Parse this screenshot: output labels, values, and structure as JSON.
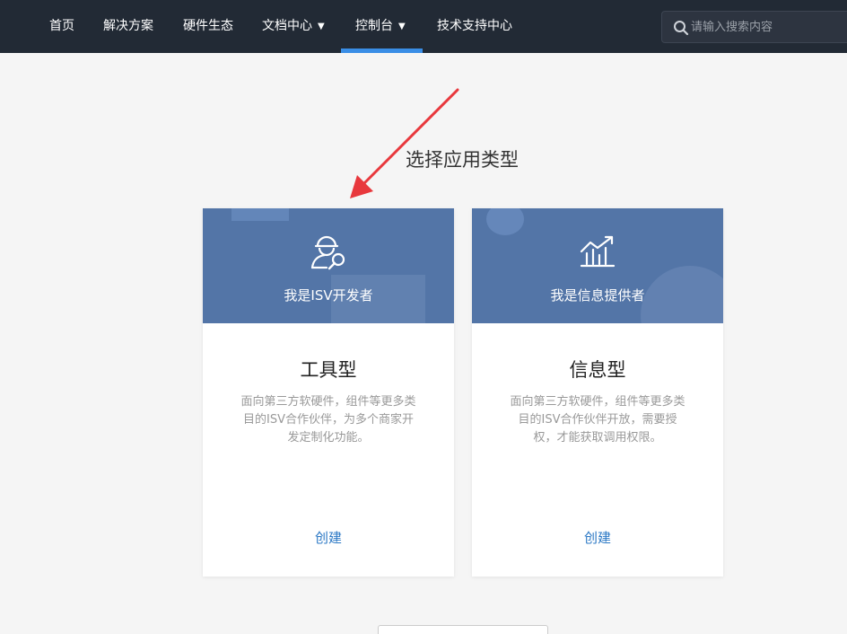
{
  "nav": {
    "items": [
      {
        "label": "首页"
      },
      {
        "label": "解决方案"
      },
      {
        "label": "硬件生态"
      },
      {
        "label": "文档中心",
        "caret": "▼"
      },
      {
        "label": "控制台",
        "caret": "▼"
      },
      {
        "label": "技术支持中心"
      }
    ],
    "active": "控制台",
    "search_placeholder": "请输入搜索内容"
  },
  "page_title": "选择应用类型",
  "cards": [
    {
      "banner_label": "我是ISV开发者",
      "icon": "developer-wrench-icon",
      "title": "工具型",
      "description": "面向第三方软硬件，组件等更多类目的ISV合作伙伴，为多个商家开发定制化功能。",
      "action": "创建"
    },
    {
      "banner_label": "我是信息提供者",
      "icon": "chart-growth-icon",
      "title": "信息型",
      "description": "面向第三方软硬件，组件等更多类目的ISV合作伙伴开放，需要授权，才能获取调用权限。",
      "action": "创建"
    }
  ],
  "colors": {
    "nav_bg": "#222a35",
    "nav_active": "#3a8ee6",
    "banner_bg": "#5375a7",
    "link": "#2b78c5",
    "annotation_arrow": "#e8383d"
  }
}
